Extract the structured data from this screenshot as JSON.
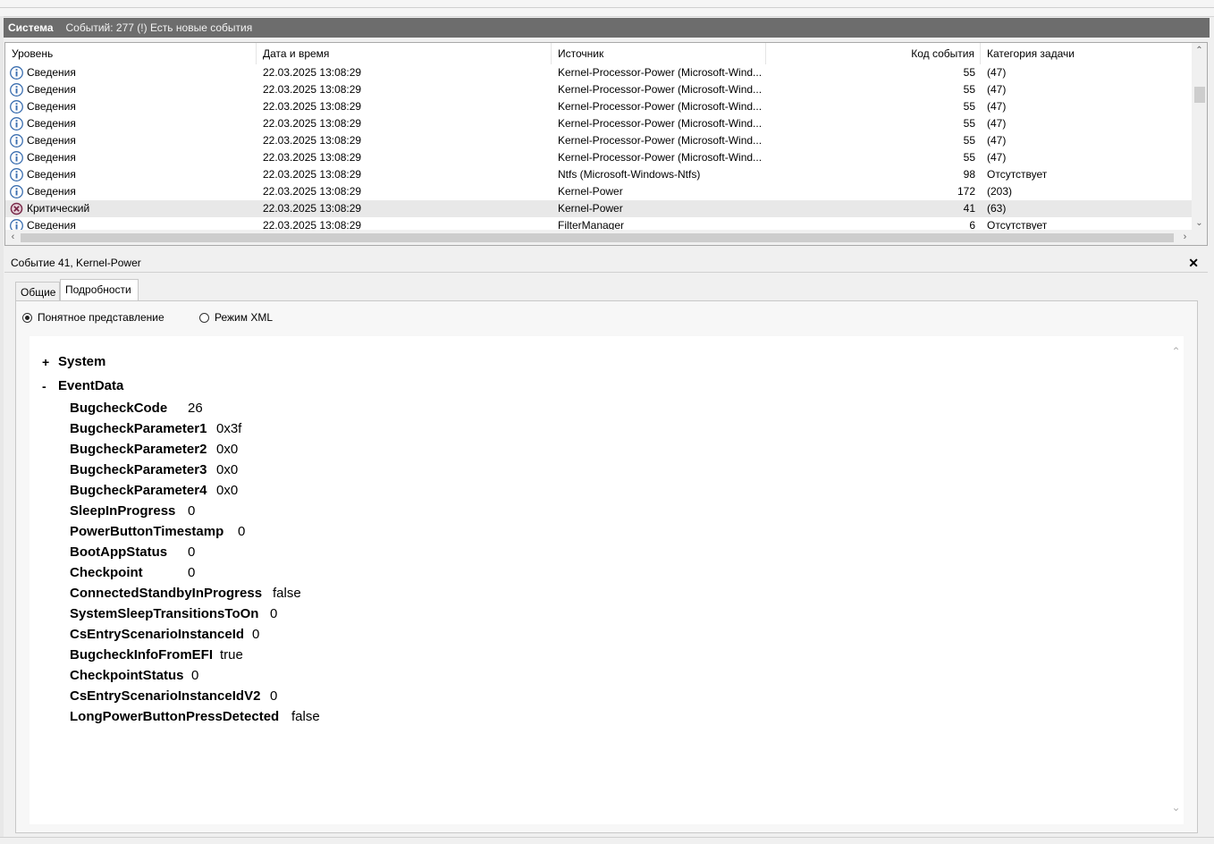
{
  "header": {
    "log_name": "Система",
    "event_count_text": "Событий: 277 (!) Есть новые события"
  },
  "columns": [
    "Уровень",
    "Дата и время",
    "Источник",
    "Код события",
    "Категория задачи"
  ],
  "rows": [
    {
      "level": "Сведения",
      "icon": "info-icon",
      "datetime": "22.03.2025 13:08:29",
      "source": "Kernel-Processor-Power (Microsoft-Wind...",
      "code": "55",
      "category": "(47)"
    },
    {
      "level": "Сведения",
      "icon": "info-icon",
      "datetime": "22.03.2025 13:08:29",
      "source": "Kernel-Processor-Power (Microsoft-Wind...",
      "code": "55",
      "category": "(47)"
    },
    {
      "level": "Сведения",
      "icon": "info-icon",
      "datetime": "22.03.2025 13:08:29",
      "source": "Kernel-Processor-Power (Microsoft-Wind...",
      "code": "55",
      "category": "(47)"
    },
    {
      "level": "Сведения",
      "icon": "info-icon",
      "datetime": "22.03.2025 13:08:29",
      "source": "Kernel-Processor-Power (Microsoft-Wind...",
      "code": "55",
      "category": "(47)"
    },
    {
      "level": "Сведения",
      "icon": "info-icon",
      "datetime": "22.03.2025 13:08:29",
      "source": "Kernel-Processor-Power (Microsoft-Wind...",
      "code": "55",
      "category": "(47)"
    },
    {
      "level": "Сведения",
      "icon": "info-icon",
      "datetime": "22.03.2025 13:08:29",
      "source": "Kernel-Processor-Power (Microsoft-Wind...",
      "code": "55",
      "category": "(47)"
    },
    {
      "level": "Сведения",
      "icon": "info-icon",
      "datetime": "22.03.2025 13:08:29",
      "source": "Ntfs (Microsoft-Windows-Ntfs)",
      "code": "98",
      "category": "Отсутствует"
    },
    {
      "level": "Сведения",
      "icon": "info-icon",
      "datetime": "22.03.2025 13:08:29",
      "source": "Kernel-Power",
      "code": "172",
      "category": "(203)"
    },
    {
      "level": "Критический",
      "icon": "critical-icon",
      "datetime": "22.03.2025 13:08:29",
      "source": "Kernel-Power",
      "code": "41",
      "category": "(63)",
      "selected": true
    },
    {
      "level": "Сведения",
      "icon": "info-icon",
      "datetime": "22.03.2025 13:08:29",
      "source": "FilterManager",
      "code": "6",
      "category": "Отсутствует"
    }
  ],
  "detail": {
    "title": "Событие 41, Kernel-Power",
    "tabs": [
      "Общие",
      "Подробности"
    ],
    "active_tab": "Подробности",
    "view_options": [
      "Понятное представление",
      "Режим XML"
    ],
    "selected_view": "Понятное представление",
    "system_node": {
      "toggle": "+",
      "label": "System"
    },
    "eventdata_node": {
      "toggle": "-",
      "label": "EventData"
    },
    "event_data": [
      {
        "key": "BugcheckCode",
        "value": "26"
      },
      {
        "key": "BugcheckParameter1",
        "value": "0x3f"
      },
      {
        "key": "BugcheckParameter2",
        "value": "0x0"
      },
      {
        "key": "BugcheckParameter3",
        "value": "0x0"
      },
      {
        "key": "BugcheckParameter4",
        "value": "0x0"
      },
      {
        "key": "SleepInProgress",
        "value": "0"
      },
      {
        "key": "PowerButtonTimestamp",
        "value": "0"
      },
      {
        "key": "BootAppStatus",
        "value": "0"
      },
      {
        "key": "Checkpoint",
        "value": "0"
      },
      {
        "key": "ConnectedStandbyInProgress",
        "value": "false"
      },
      {
        "key": "SystemSleepTransitionsToOn",
        "value": "0"
      },
      {
        "key": "CsEntryScenarioInstanceId",
        "value": "0"
      },
      {
        "key": "BugcheckInfoFromEFI",
        "value": "true"
      },
      {
        "key": "CheckpointStatus",
        "value": "0"
      },
      {
        "key": "CsEntryScenarioInstanceIdV2",
        "value": "0"
      },
      {
        "key": "LongPowerButtonPressDetected",
        "value": "false"
      }
    ]
  },
  "colors": {
    "titlebar": "#6d6d6d",
    "info": "#3c6fb0",
    "critical": "#7a2a4a",
    "selected_row": "#e8e8e8"
  }
}
